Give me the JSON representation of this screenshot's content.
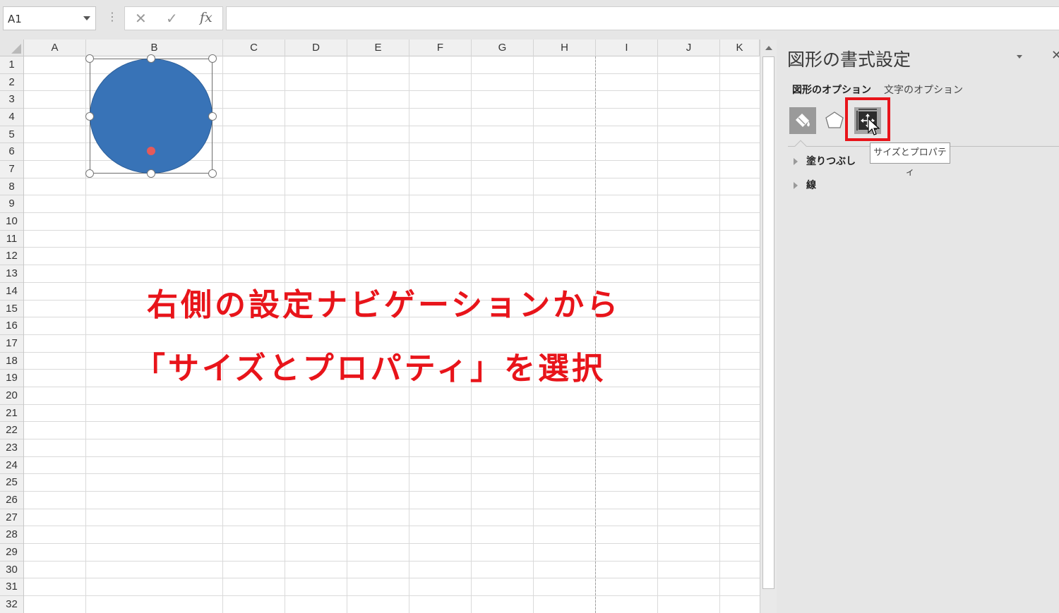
{
  "namebox": {
    "value": "A1"
  },
  "formula_bar": {
    "cancel_icon": "✕",
    "enter_icon": "✓",
    "fx_label": "fx",
    "value": ""
  },
  "columns": [
    "A",
    "B",
    "C",
    "D",
    "E",
    "F",
    "G",
    "H",
    "I",
    "J",
    "K"
  ],
  "rows": [
    "1",
    "2",
    "3",
    "4",
    "5",
    "6",
    "7",
    "8",
    "9",
    "10",
    "11",
    "12",
    "13",
    "14",
    "15",
    "16",
    "17",
    "18",
    "19",
    "20",
    "21",
    "22",
    "23",
    "24",
    "25",
    "26",
    "27",
    "28",
    "29",
    "30",
    "31",
    "32"
  ],
  "shape": {
    "type": "oval",
    "fill": "#3873b7"
  },
  "annotation": {
    "line1": "右側の設定ナビゲーションから",
    "line2": "「サイズとプロパティ」を選択",
    "color": "#e8141a"
  },
  "pane": {
    "title": "図形の書式設定",
    "tabs": {
      "shape_options": "図形のオプション",
      "text_options": "文字のオプション"
    },
    "icons": [
      "fill-line-icon",
      "effects-icon",
      "size-properties-icon"
    ],
    "sections": [
      "塗りつぶし",
      "線"
    ],
    "tooltip": "サイズとプロパティ",
    "close": "✕"
  }
}
